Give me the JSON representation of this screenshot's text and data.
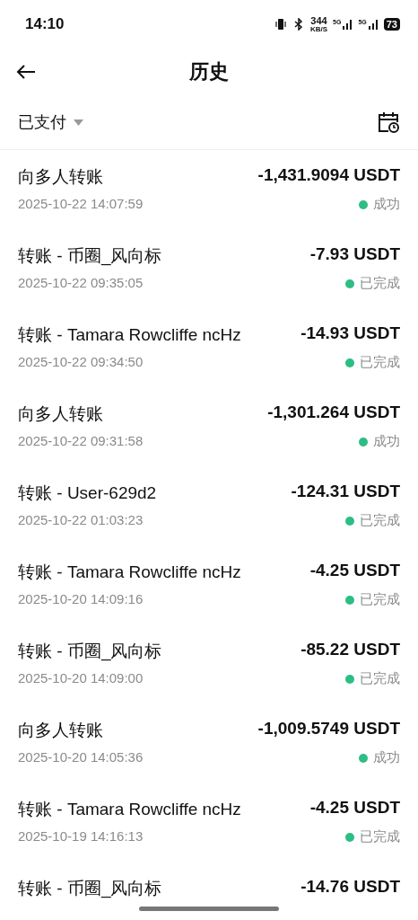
{
  "status_bar": {
    "time": "14:10",
    "speed": "344",
    "speed_unit": "KB/S",
    "network_1": "5G",
    "network_2": "5G",
    "battery": "73"
  },
  "header": {
    "title": "历史"
  },
  "filter": {
    "label": "已支付"
  },
  "transactions": [
    {
      "title": "向多人转账",
      "amount": "-1,431.9094 USDT",
      "date": "2025-10-22 14:07:59",
      "status": "成功"
    },
    {
      "title": "转账 - 币圈_风向标",
      "amount": "-7.93 USDT",
      "date": "2025-10-22 09:35:05",
      "status": "已完成"
    },
    {
      "title": "转账 - Tamara Rowcliffe ncHz",
      "amount": "-14.93 USDT",
      "date": "2025-10-22 09:34:50",
      "status": "已完成"
    },
    {
      "title": "向多人转账",
      "amount": "-1,301.264 USDT",
      "date": "2025-10-22 09:31:58",
      "status": "成功"
    },
    {
      "title": "转账 - User-629d2",
      "amount": "-124.31 USDT",
      "date": "2025-10-22 01:03:23",
      "status": "已完成"
    },
    {
      "title": "转账 - Tamara Rowcliffe ncHz",
      "amount": "-4.25 USDT",
      "date": "2025-10-20 14:09:16",
      "status": "已完成"
    },
    {
      "title": "转账 - 币圈_风向标",
      "amount": "-85.22 USDT",
      "date": "2025-10-20 14:09:00",
      "status": "已完成"
    },
    {
      "title": "向多人转账",
      "amount": "-1,009.5749 USDT",
      "date": "2025-10-20 14:05:36",
      "status": "成功"
    },
    {
      "title": "转账 - Tamara Rowcliffe ncHz",
      "amount": "-4.25 USDT",
      "date": "2025-10-19 14:16:13",
      "status": "已完成"
    },
    {
      "title": "转账 - 币圈_风向标",
      "amount": "-14.76 USDT"
    }
  ]
}
